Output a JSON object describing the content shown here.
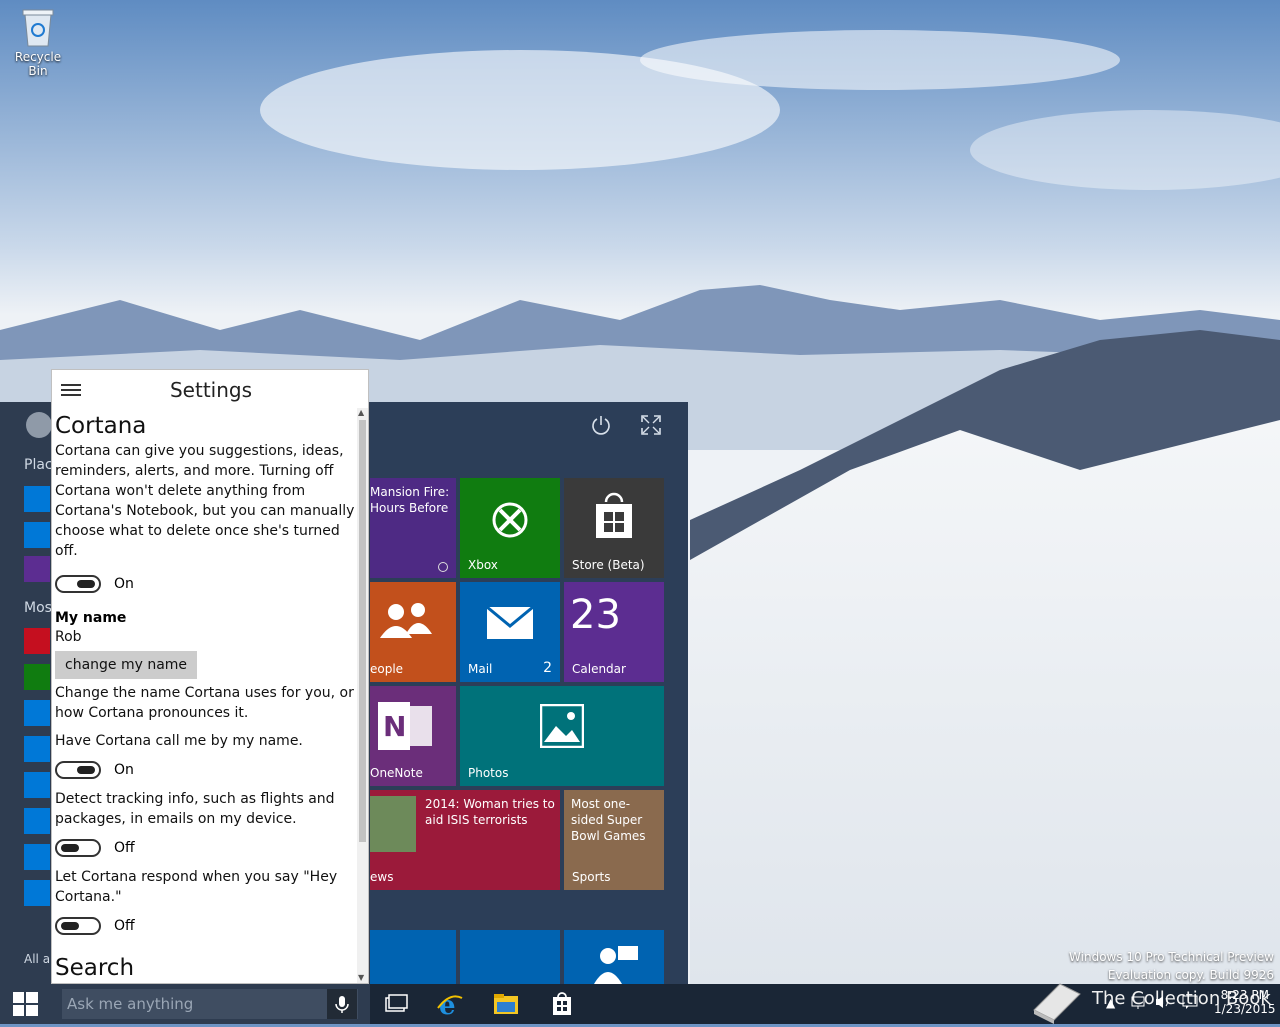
{
  "desktop": {
    "recycle_bin_label": "Recycle Bin",
    "watermark_line1": "Windows 10 Pro Technical Preview",
    "watermark_line2": "Evaluation copy. Build 9926"
  },
  "start_menu": {
    "left_fragments": {
      "places": "Plac",
      "most_used": "Mos",
      "all_apps": "All a"
    },
    "tiles": {
      "news_headline": "Mansion Fire: Hours Before",
      "xbox": "Xbox",
      "store": "Store (Beta)",
      "people": "eople",
      "mail": "Mail",
      "mail_count": "2",
      "calendar_day": "23",
      "calendar": "Calendar",
      "onenote": "OneNote",
      "photos": "Photos",
      "news_story": "2014: Woman tries to aid ISIS terrorists",
      "news": "ews",
      "sports_story": "Most one-sided Super Bowl Games",
      "sports": "Sports"
    }
  },
  "cortana": {
    "header_title": "Settings",
    "section_title": "Cortana",
    "intro": "Cortana can give you suggestions, ideas, reminders, alerts, and more. Turning off Cortana won't delete anything from Cortana's Notebook, but you can manually choose what to delete once she's turned off.",
    "toggle1_state": "On",
    "my_name_label": "My name",
    "my_name_value": "Rob",
    "change_name_button": "change my name",
    "change_name_desc": "Change the name Cortana uses for you, or how Cortana pronounces it.",
    "call_by_name_label": "Have Cortana call me by my name.",
    "toggle2_state": "On",
    "tracking_label": "Detect tracking info, such as flights and packages, in emails on my device.",
    "toggle3_state": "Off",
    "hey_cortana_label": "Let Cortana respond when you say \"Hey Cortana.\"",
    "toggle4_state": "Off",
    "search_section_title": "Search"
  },
  "taskbar": {
    "search_placeholder": "Ask me anything",
    "clock_time": "8:23 PM",
    "clock_date": "1/23/2015",
    "watermark_overlay": "The Collection Book"
  },
  "colors": {
    "start_bg": "#2c3e58",
    "taskbar_bg": "#1a2636",
    "tile_purple": "#4e2a84",
    "tile_green": "#107c10",
    "tile_dark": "#3a3a3a",
    "tile_orange": "#c2501c",
    "tile_blue": "#0063b1",
    "tile_violet": "#6b2e7a",
    "tile_teal": "#00727a",
    "tile_crimson": "#9b1a3a"
  }
}
